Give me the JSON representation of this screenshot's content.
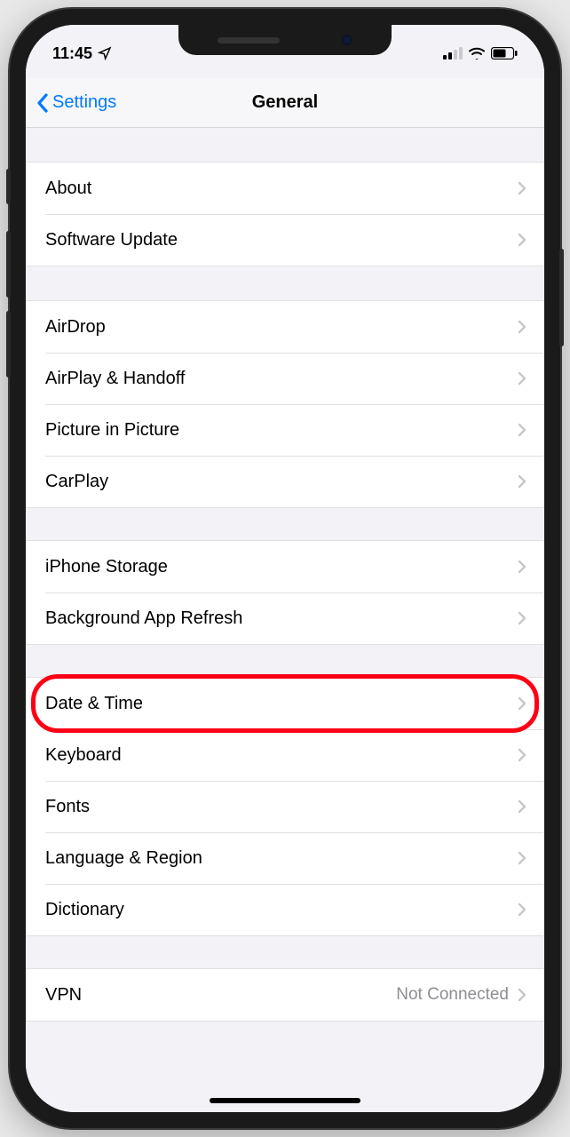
{
  "status": {
    "time": "11:45",
    "location_icon": "location-arrow"
  },
  "nav": {
    "back_label": "Settings",
    "title": "General"
  },
  "groups": [
    {
      "items": [
        {
          "label": "About",
          "value": ""
        },
        {
          "label": "Software Update",
          "value": ""
        }
      ]
    },
    {
      "items": [
        {
          "label": "AirDrop",
          "value": ""
        },
        {
          "label": "AirPlay & Handoff",
          "value": ""
        },
        {
          "label": "Picture in Picture",
          "value": ""
        },
        {
          "label": "CarPlay",
          "value": ""
        }
      ]
    },
    {
      "items": [
        {
          "label": "iPhone Storage",
          "value": ""
        },
        {
          "label": "Background App Refresh",
          "value": ""
        }
      ]
    },
    {
      "items": [
        {
          "label": "Date & Time",
          "value": "",
          "highlight": true
        },
        {
          "label": "Keyboard",
          "value": ""
        },
        {
          "label": "Fonts",
          "value": ""
        },
        {
          "label": "Language & Region",
          "value": ""
        },
        {
          "label": "Dictionary",
          "value": ""
        }
      ]
    },
    {
      "items": [
        {
          "label": "VPN",
          "value": "Not Connected"
        }
      ]
    }
  ]
}
